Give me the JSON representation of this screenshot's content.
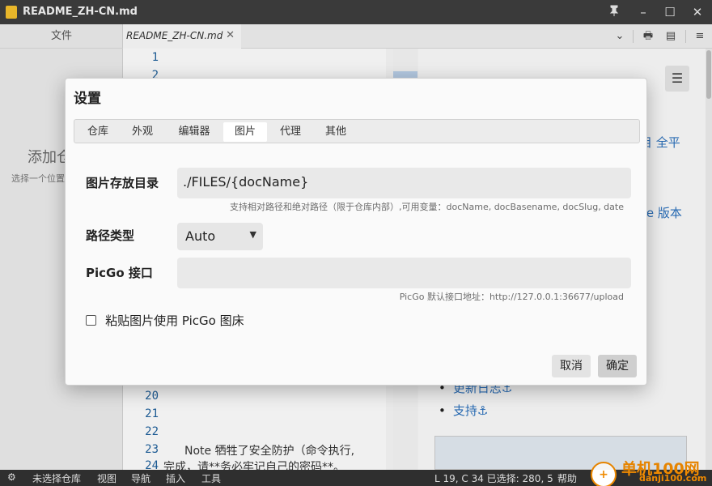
{
  "window": {
    "title": "README_ZH-CN.md"
  },
  "sidebar": {
    "tab_label": "文件",
    "add_repo_text": "添加仓",
    "add_repo_hint": "选择一个位置"
  },
  "editor": {
    "tab_name": "README_ZH-CN.md",
    "line_numbers_top": [
      "1",
      "2"
    ],
    "line_numbers_bottom": [
      "20",
      "21",
      "22",
      "23",
      "24"
    ],
    "line_23_text": "Note 牺牲了安全防护（命令执行,",
    "line_24_text": "完成，请**务必牢记自己的密码**。"
  },
  "preview": {
    "text_1": "目 全平",
    "text_2": "re 版本",
    "bullet_1": "更新日志⚓",
    "bullet_2": "支持⚓"
  },
  "dialog": {
    "title": "设置",
    "tabs": [
      {
        "label": "仓库",
        "active": false
      },
      {
        "label": "外观",
        "active": false
      },
      {
        "label": "编辑器",
        "active": false
      },
      {
        "label": "图片",
        "active": true
      },
      {
        "label": "代理",
        "active": false
      },
      {
        "label": "其他",
        "active": false
      }
    ],
    "image_dir_label": "图片存放目录",
    "image_dir_value": "./FILES/{docName}",
    "image_dir_hint": "支持相对路径和绝对路径（限于仓库内部）,可用变量：docName, docBasename, docSlug, date",
    "path_type_label": "路径类型",
    "path_type_value": "Auto",
    "picgo_label": "PicGo 接口",
    "picgo_value": "",
    "picgo_hint": "PicGo 默认接口地址：http://127.0.0.1:36677/upload",
    "paste_checkbox_label": "粘贴图片使用 PicGo 图床",
    "paste_checkbox_checked": false,
    "cancel_label": "取消",
    "ok_label": "确定"
  },
  "statusbar": {
    "repo_label": "未选择仓库",
    "view_label": "视图",
    "nav_label": "导航",
    "insert_label": "插入",
    "tools_label": "工具",
    "cursor_info": "L 19, C 34 已选择: 280, 5",
    "help_label": "帮助",
    "watermark_brand": "单机100网",
    "watermark_site": "danji100.com"
  },
  "icons": {
    "pin": "pin-icon",
    "minimize": "minimize-icon",
    "maximize": "maximize-icon",
    "close": "close-icon",
    "chevron": "chevron-down-icon",
    "print": "print-icon",
    "export": "export-icon",
    "settings": "sliders-icon",
    "toc": "list-icon",
    "gear": "gear-icon"
  }
}
